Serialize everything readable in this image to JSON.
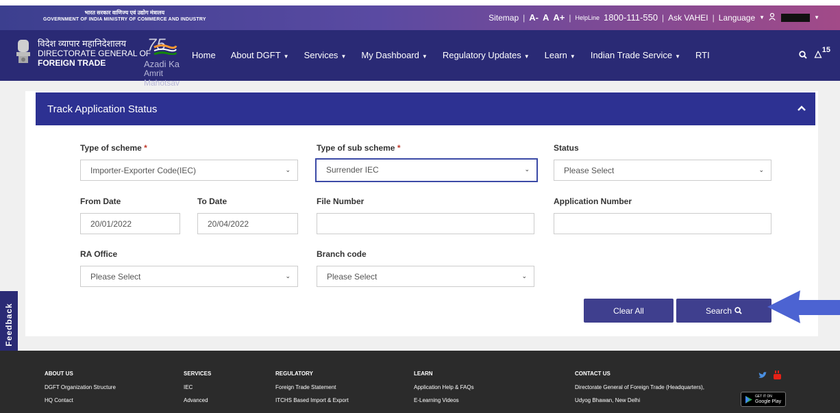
{
  "gov_header": {
    "hindi_line": "भारत सरकार   वाणिज्य एवं उद्योग मंत्रालय",
    "english_line": "GOVERNMENT OF INDIA  MINISTRY OF COMMERCE AND INDUSTRY"
  },
  "utility": {
    "sitemap": "Sitemap",
    "font_decrease": "A-",
    "font_normal": "A",
    "font_increase": "A+",
    "helpline": "HelpLine",
    "phone": "1800-111-550",
    "ask": "Ask VAHEI",
    "language": "Language"
  },
  "brand": {
    "hindi": "विदेश व्यापार महानिदेशालय",
    "line1": "DIRECTORATE GENERAL OF",
    "line2": "FOREIGN TRADE",
    "azadi_number": "75",
    "azadi_line1": "Azadi Ka",
    "azadi_line2": "Amrit Mahotsav"
  },
  "nav": {
    "items": [
      {
        "label": "Home",
        "dropdown": false
      },
      {
        "label": "About DGFT",
        "dropdown": true
      },
      {
        "label": "Services",
        "dropdown": true
      },
      {
        "label": "My Dashboard",
        "dropdown": true
      },
      {
        "label": "Regulatory Updates",
        "dropdown": true
      },
      {
        "label": "Learn",
        "dropdown": true
      },
      {
        "label": "Indian Trade Service",
        "dropdown": true
      },
      {
        "label": "RTI",
        "dropdown": false
      }
    ],
    "notification_count": "15"
  },
  "panel": {
    "title": "Track Application Status",
    "fields": {
      "scheme": {
        "label": "Type of scheme",
        "required": "*",
        "value": "Importer-Exporter Code(IEC)"
      },
      "sub_scheme": {
        "label": "Type of sub scheme",
        "required": "*",
        "value": "Surrender IEC"
      },
      "status": {
        "label": "Status",
        "value": "Please Select"
      },
      "from_date": {
        "label": "From Date",
        "value": "20/01/2022"
      },
      "to_date": {
        "label": "To Date",
        "value": "20/04/2022"
      },
      "file_number": {
        "label": "File Number",
        "value": ""
      },
      "application_number": {
        "label": "Application Number",
        "value": ""
      },
      "ra_office": {
        "label": "RA Office",
        "value": "Please Select"
      },
      "branch_code": {
        "label": "Branch code",
        "value": "Please Select"
      }
    },
    "clear_label": "Clear All",
    "search_label": "Search"
  },
  "feedback_label": "Feedback",
  "footer": {
    "about": {
      "heading": "ABOUT US",
      "items": [
        "DGFT Organization Structure",
        "HQ Contact"
      ]
    },
    "services": {
      "heading": "SERVICES",
      "items": [
        "IEC",
        "Advanced"
      ]
    },
    "regulatory": {
      "heading": "REGULATORY",
      "items": [
        "Foreign Trade Statement",
        "ITCHS Based Import & Export"
      ]
    },
    "learn": {
      "heading": "LEARN",
      "items": [
        "Application Help & FAQs",
        "E-Learning Videos"
      ]
    },
    "contact": {
      "heading": "CONTACT US",
      "items": [
        "Directorate General of Foreign Trade (Headquarters),",
        "Udyog Bhawan, New Delhi"
      ]
    },
    "gplay_top": "GET IT ON",
    "gplay_bottom": "Google Play"
  },
  "colors": {
    "primary": "#2d3192",
    "nav_bg": "#2a2a75",
    "button": "#3f3f8e",
    "arrow": "#4c63d2",
    "footer_bg": "#2b2b2b"
  }
}
